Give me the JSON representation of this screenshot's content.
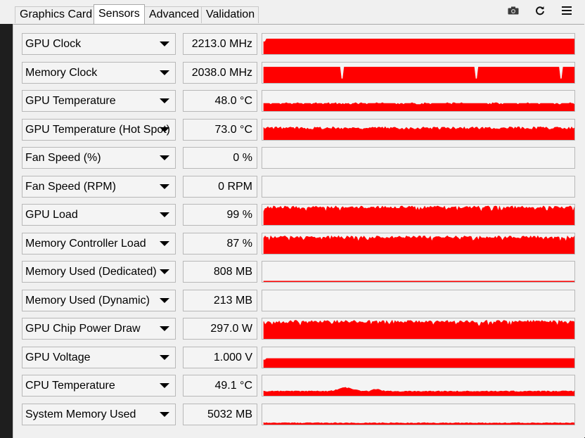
{
  "tabs": [
    {
      "label": "Graphics Card",
      "active": false
    },
    {
      "label": "Sensors",
      "active": true
    },
    {
      "label": "Advanced",
      "active": false
    },
    {
      "label": "Validation",
      "active": false
    }
  ],
  "toolbar": {
    "camera_icon": "camera-icon",
    "refresh_icon": "refresh-icon",
    "menu_icon": "hamburger-menu-icon"
  },
  "colors": {
    "graph": "#ff0000"
  },
  "sensors": [
    {
      "name": "GPU Clock",
      "value": "2213.0 MHz",
      "level": 0.75,
      "pattern": "flatfull"
    },
    {
      "name": "Memory Clock",
      "value": "2038.0 MHz",
      "level": 0.78,
      "pattern": "flatdips"
    },
    {
      "name": "GPU Temperature",
      "value": "48.0 °C",
      "level": 0.38,
      "pattern": "slight"
    },
    {
      "name": "GPU Temperature (Hot Spot)",
      "value": "73.0 °C",
      "level": 0.58,
      "pattern": "jitter"
    },
    {
      "name": "Fan Speed (%)",
      "value": "0 %",
      "level": 0,
      "pattern": "none"
    },
    {
      "name": "Fan Speed (RPM)",
      "value": "0 RPM",
      "level": 0,
      "pattern": "none"
    },
    {
      "name": "GPU Load",
      "value": "99 %",
      "level": 0.9,
      "pattern": "noisy"
    },
    {
      "name": "Memory Controller Load",
      "value": "87 %",
      "level": 0.85,
      "pattern": "noisy"
    },
    {
      "name": "Memory Used (Dedicated)",
      "value": "808 MB",
      "level": 0.04,
      "pattern": "line"
    },
    {
      "name": "Memory Used (Dynamic)",
      "value": "213 MB",
      "level": 0,
      "pattern": "none"
    },
    {
      "name": "GPU Chip Power Draw",
      "value": "297.0 W",
      "level": 0.88,
      "pattern": "noisy"
    },
    {
      "name": "GPU Voltage",
      "value": "1.000 V",
      "level": 0.45,
      "pattern": "flat"
    },
    {
      "name": "CPU Temperature",
      "value": "49.1 °C",
      "level": 0.22,
      "pattern": "bumps"
    },
    {
      "name": "System Memory Used",
      "value": "5032 MB",
      "level": 0.08,
      "pattern": "low"
    }
  ]
}
